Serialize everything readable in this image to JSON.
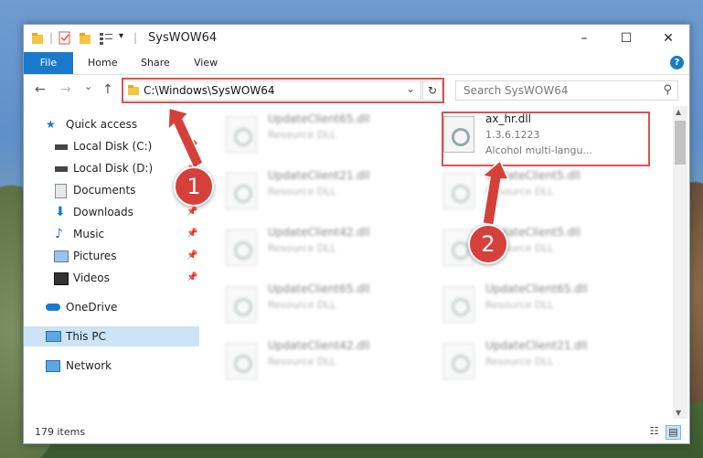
{
  "window": {
    "title": "SysWOW64",
    "minimize": "–",
    "maximize": "☐",
    "close": "✕"
  },
  "ribbon": {
    "tabs": [
      "File",
      "Home",
      "Share",
      "View"
    ],
    "help": "?"
  },
  "nav": {
    "back": "←",
    "forward": "→",
    "recent": "⌄",
    "up": "↑",
    "address": "C:\\Windows\\SysWOW64",
    "address_dropdown": "⌄",
    "refresh": "↻",
    "search_placeholder": "Search SysWOW64"
  },
  "sidebar": {
    "items": [
      {
        "label": "Quick access",
        "icon": "star-icon"
      },
      {
        "label": "Local Disk (C:)",
        "icon": "drive-icon",
        "pinned": true
      },
      {
        "label": "Local Disk (D:)",
        "icon": "drive-icon",
        "pinned": true
      },
      {
        "label": "Documents",
        "icon": "documents-icon",
        "pinned": true
      },
      {
        "label": "Downloads",
        "icon": "download-icon",
        "pinned": true
      },
      {
        "label": "Music",
        "icon": "music-icon",
        "pinned": true
      },
      {
        "label": "Pictures",
        "icon": "pictures-icon",
        "pinned": true
      },
      {
        "label": "Videos",
        "icon": "videos-icon",
        "pinned": true
      },
      {
        "label": "OneDrive",
        "icon": "cloud-icon"
      },
      {
        "label": "This PC",
        "icon": "computer-icon",
        "selected": true
      },
      {
        "label": "Network",
        "icon": "network-icon"
      }
    ],
    "pin_glyph": "📌"
  },
  "files": {
    "highlighted": {
      "name": "ax_hr.dll",
      "version": "1.3.6.1223",
      "description": "Alcohol multi-langu..."
    },
    "left_column": [
      {
        "name": "UpdateClient65.dll",
        "type": "Resource DLL"
      },
      {
        "name": "UpdateClient21.dll",
        "type": "Resource DLL"
      },
      {
        "name": "UpdateClient42.dll",
        "type": "Resource DLL"
      },
      {
        "name": "UpdateClient65.dll",
        "type": "Resource DLL"
      },
      {
        "name": "UpdateClient42.dll",
        "type": "Resource DLL"
      }
    ],
    "right_column": [
      {
        "name": "UpdateClient5.dll",
        "type": "Resource DLL"
      },
      {
        "name": "UpdateClient5.dll",
        "type": "Resource DLL"
      },
      {
        "name": "UpdateClient65.dll",
        "type": "Resource DLL"
      },
      {
        "name": "UpdateClient21.dll",
        "type": "Resource DLL"
      }
    ]
  },
  "status": {
    "count": "179 items"
  },
  "markers": [
    "1",
    "2"
  ],
  "colors": {
    "accent": "#1979ca",
    "highlight": "#d9534f",
    "marker": "#d6403a",
    "selected": "#cde4f7"
  }
}
